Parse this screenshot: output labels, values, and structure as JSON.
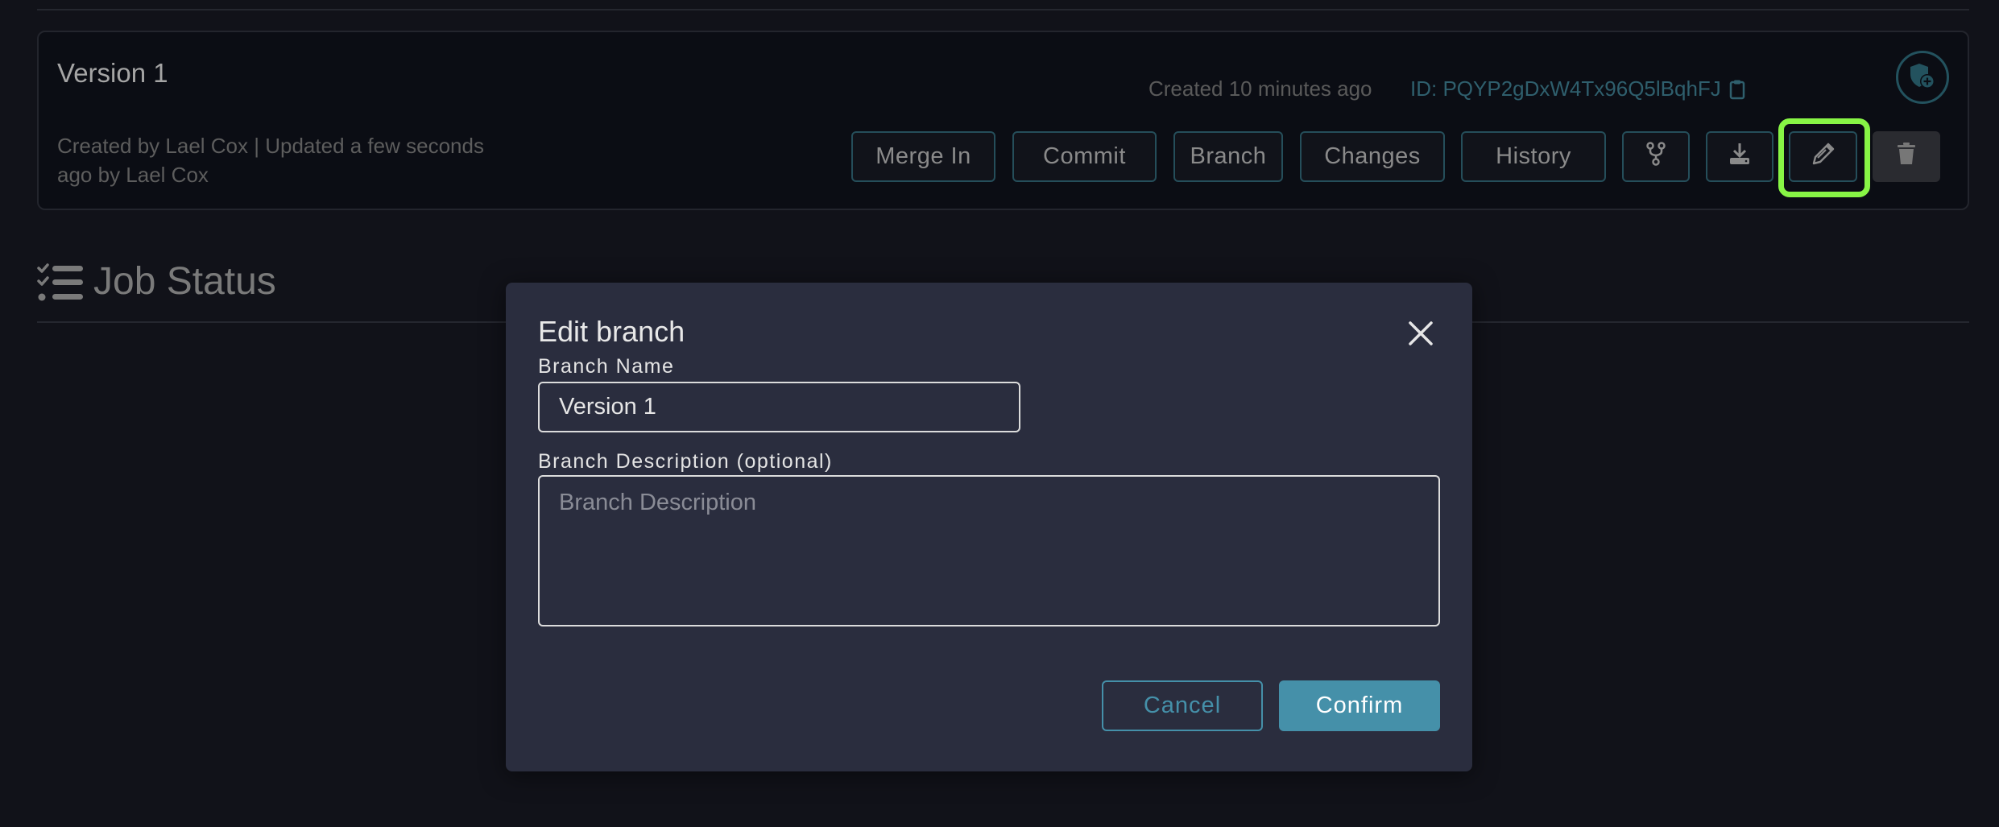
{
  "version_card": {
    "title": "Version 1",
    "meta": "Created by Lael Cox | Updated a few seconds ago by Lael Cox",
    "created": "Created 10 minutes ago",
    "id_text": "ID: PQYP2gDxW4Tx96Q5lBqhFJ",
    "icons": {
      "shield": "shield-plus-icon",
      "copy": "clipboard-icon"
    },
    "actions": [
      {
        "label": "Merge In"
      },
      {
        "label": "Commit"
      },
      {
        "label": "Branch"
      },
      {
        "label": "Changes"
      },
      {
        "label": "History"
      },
      {
        "icon": "fork-icon"
      },
      {
        "icon": "download-icon"
      },
      {
        "icon": "pencil-icon",
        "highlighted": true
      },
      {
        "icon": "trash-icon"
      }
    ],
    "highlight_color": "#87f545"
  },
  "job_status": {
    "title": "Job Status",
    "icon": "checklist-icon"
  },
  "modal": {
    "title": "Edit branch",
    "name_label": "Branch Name",
    "name_value": "Version 1",
    "desc_label": "Branch Description (optional)",
    "desc_placeholder": "Branch Description",
    "desc_value": "",
    "cancel_label": "Cancel",
    "confirm_label": "Confirm",
    "accent_color": "#4590a9"
  }
}
